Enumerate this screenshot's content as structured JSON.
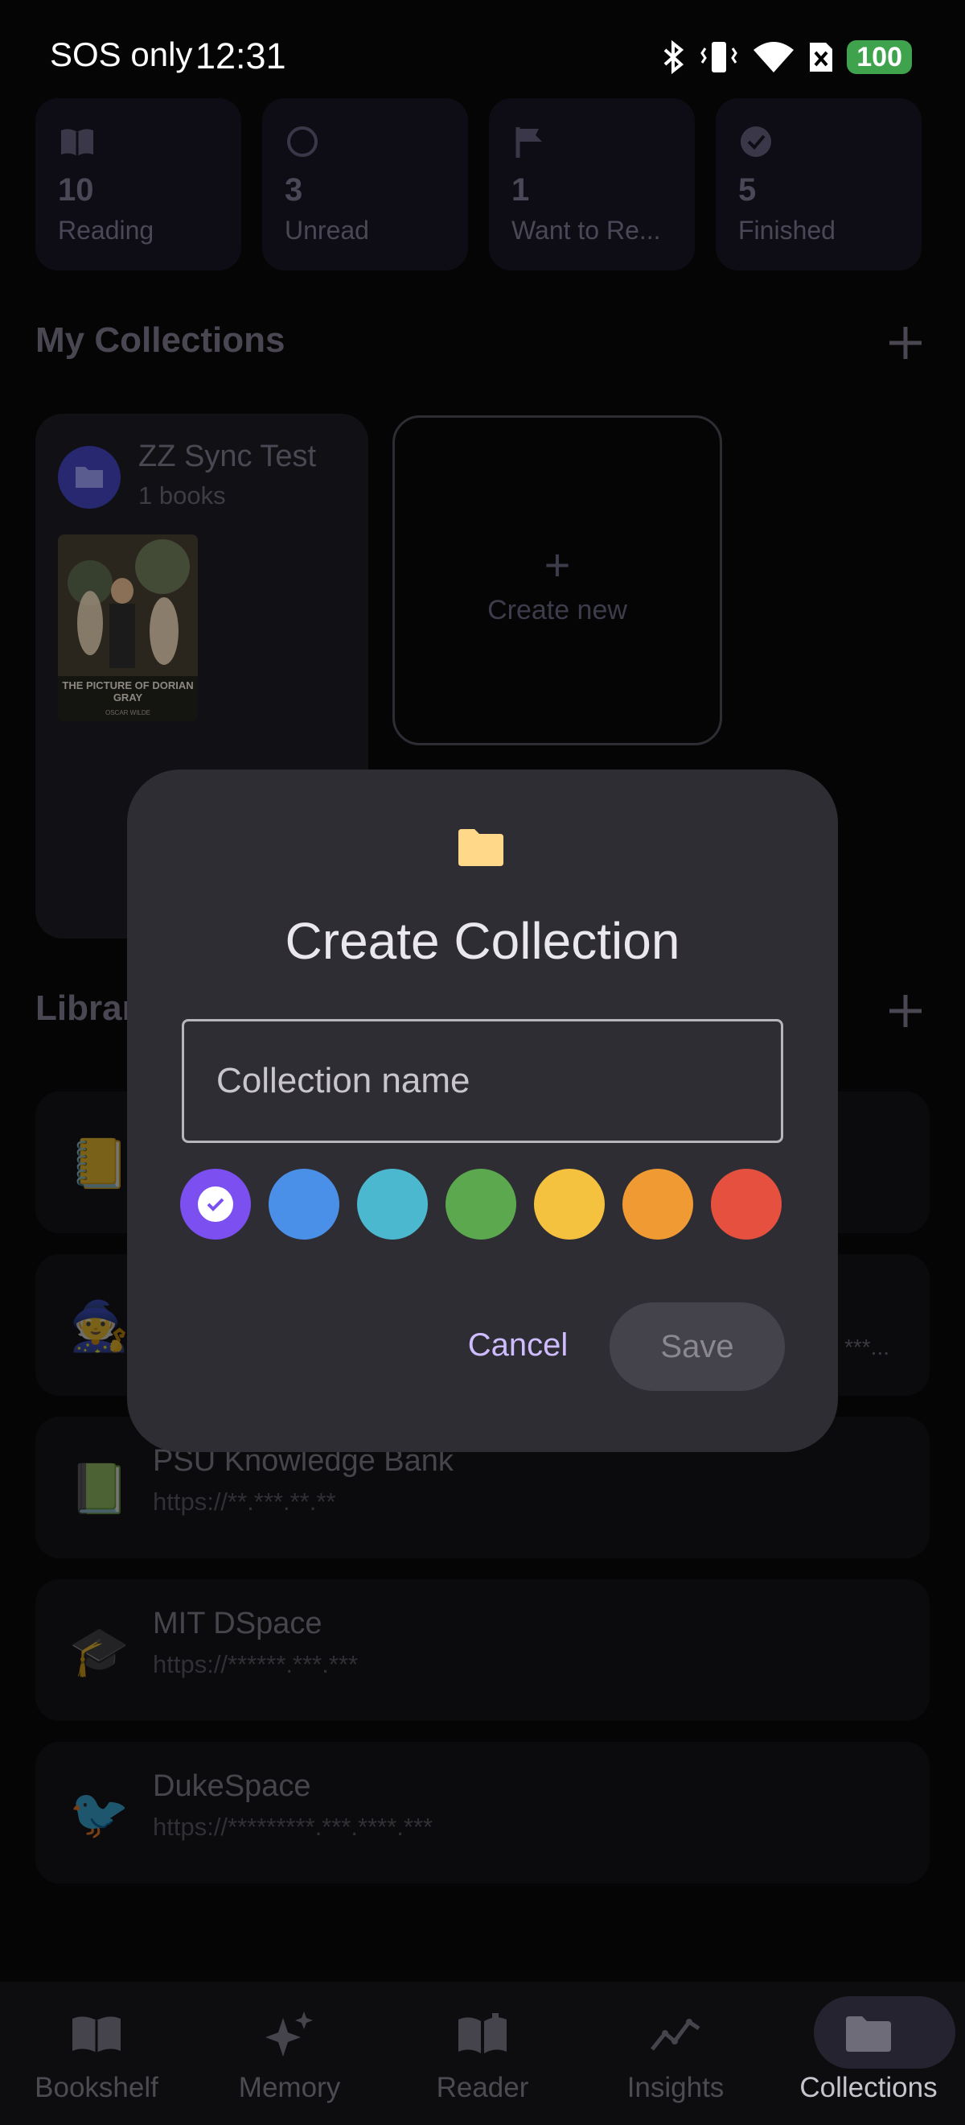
{
  "status_bar": {
    "carrier": "SOS only",
    "time": "12:31",
    "battery": "100"
  },
  "stats": [
    {
      "icon": "book-open-icon",
      "value": "10",
      "label": "Reading"
    },
    {
      "icon": "circle-outline-icon",
      "value": "3",
      "label": "Unread"
    },
    {
      "icon": "flag-icon",
      "value": "1",
      "label": "Want to Re..."
    },
    {
      "icon": "check-circle-icon",
      "value": "5",
      "label": "Finished"
    }
  ],
  "collections": {
    "title": "My Collections",
    "items": [
      {
        "name": "ZZ Sync Test",
        "count": "1 books",
        "cover_title": "THE PICTURE OF DORIAN GRAY",
        "cover_author": "OSCAR WILDE"
      }
    ],
    "create_label": "Create new",
    "create_plus": "+"
  },
  "library": {
    "title": "Librar",
    "rows": [
      {
        "emoji": "📒",
        "name": "",
        "url": "",
        "trail": ""
      },
      {
        "emoji": "🧙",
        "name": "",
        "url": "",
        "trail": "***..."
      },
      {
        "emoji": "📗",
        "name": "PSU Knowledge Bank",
        "url": "https://**.***.**.**",
        "trail": ""
      },
      {
        "emoji": "🎓",
        "name": "MIT DSpace",
        "url": "https://******.***.***",
        "trail": ""
      },
      {
        "emoji": "🐦",
        "name": "DukeSpace",
        "url": "https://*********.***.****.***",
        "trail": ""
      }
    ]
  },
  "dialog": {
    "title": "Create Collection",
    "input_placeholder": "Collection name",
    "input_value": "",
    "colors": [
      "#7b4ff0",
      "#4a90e8",
      "#4cb8cf",
      "#5ba84e",
      "#f4c23f",
      "#f09a34",
      "#e5503f"
    ],
    "selected_color_index": 0,
    "cancel_label": "Cancel",
    "save_label": "Save",
    "icon_color": "#ffd88a"
  },
  "bottom_nav": [
    {
      "label": "Bookshelf",
      "icon": "book-open-icon",
      "active": false
    },
    {
      "label": "Memory",
      "icon": "sparkles-icon",
      "active": false
    },
    {
      "label": "Reader",
      "icon": "reader-book-icon",
      "active": false
    },
    {
      "label": "Insights",
      "icon": "trend-chart-icon",
      "active": false
    },
    {
      "label": "Collections",
      "icon": "folder-icon",
      "active": true
    }
  ]
}
